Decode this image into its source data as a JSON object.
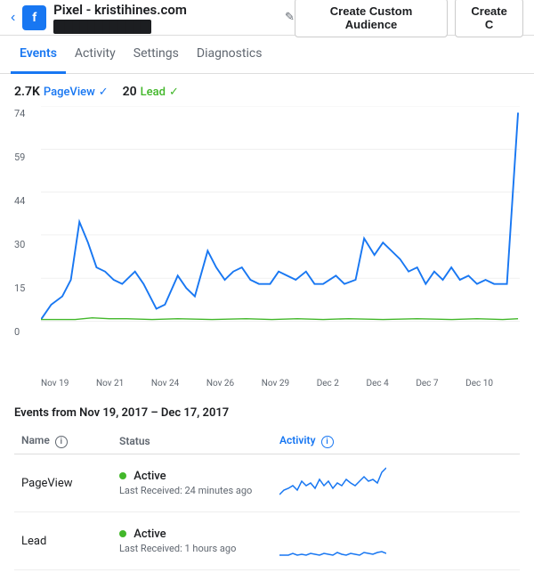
{
  "header": {
    "back_icon": "‹",
    "pixel_icon_letter": "f",
    "title": "Pixel - kristihines.com",
    "edit_icon": "✎",
    "masked_text": "████████████",
    "btn_create_audience": "Create Custom Audience",
    "btn_create": "Create C"
  },
  "tabs": [
    {
      "label": "Events",
      "active": true
    },
    {
      "label": "Activity",
      "active": false
    },
    {
      "label": "Settings",
      "active": false
    },
    {
      "label": "Diagnostics",
      "active": false
    }
  ],
  "chart": {
    "legend": [
      {
        "value": "2.7K",
        "label": "PageView",
        "check_color": "blue"
      },
      {
        "value": "20",
        "label": "Lead",
        "check_color": "green"
      }
    ],
    "y_labels": [
      "74",
      "59",
      "44",
      "30",
      "15",
      "0"
    ],
    "x_labels": [
      "Nov 19",
      "Nov 21",
      "Nov 24",
      "Nov 26",
      "Nov 29",
      "Dec 2",
      "Dec 4",
      "Dec 7",
      "Dec 10"
    ]
  },
  "events": {
    "title": "Events from Nov 19, 2017 – Dec 17, 2017",
    "columns": [
      "Name",
      "Status",
      "Activity"
    ],
    "rows": [
      {
        "name": "PageView",
        "status_label": "Active",
        "status_sub": "Last Received: 24 minutes ago"
      },
      {
        "name": "Lead",
        "status_label": "Active",
        "status_sub": "Last Received: 1 hours ago"
      }
    ]
  }
}
